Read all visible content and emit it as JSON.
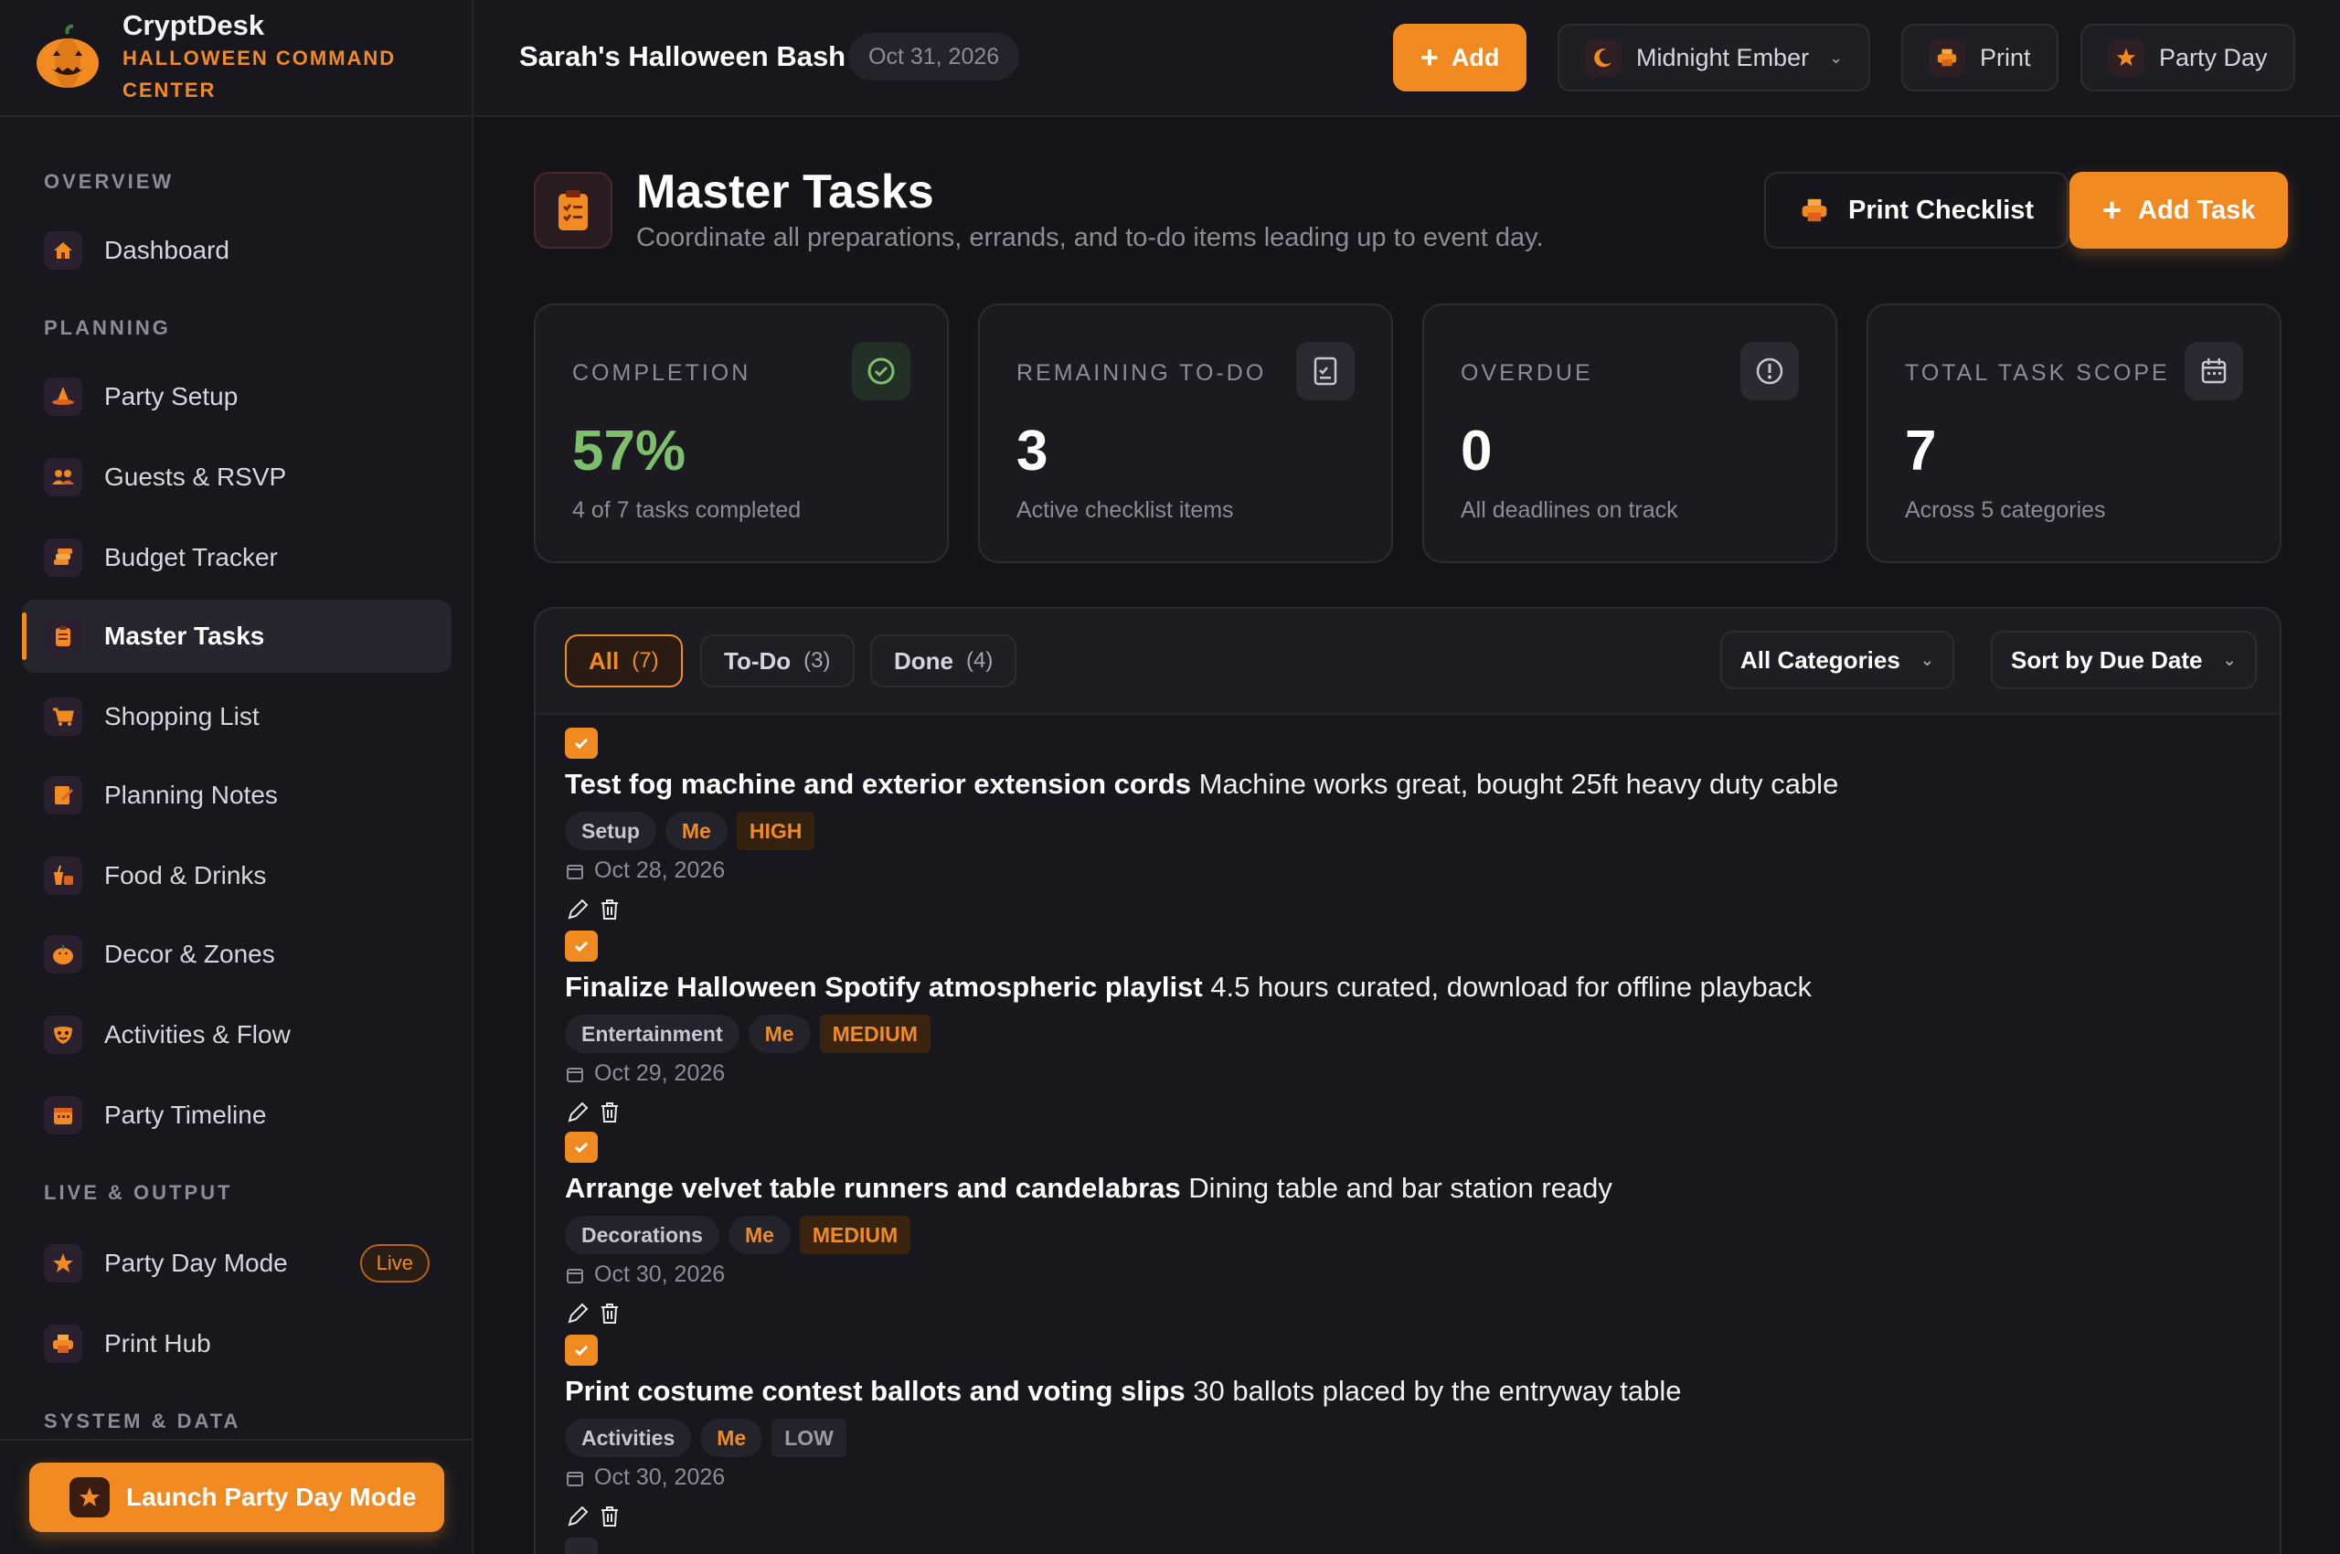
{
  "brand": {
    "name": "CryptDesk",
    "tagline_line1": "HALLOWEEN COMMAND",
    "tagline_line2": "CENTER"
  },
  "sidebar": {
    "sections": [
      "OVERVIEW",
      "PLANNING",
      "LIVE & OUTPUT",
      "SYSTEM & DATA"
    ],
    "items": [
      {
        "label": "Dashboard",
        "icon": "home-icon"
      },
      {
        "label": "Party Setup",
        "icon": "witch-hat-icon"
      },
      {
        "label": "Guests & RSVP",
        "icon": "people-icon"
      },
      {
        "label": "Budget Tracker",
        "icon": "coins-icon"
      },
      {
        "label": "Master Tasks",
        "icon": "clipboard-icon"
      },
      {
        "label": "Shopping List",
        "icon": "cart-icon"
      },
      {
        "label": "Planning Notes",
        "icon": "notepad-icon"
      },
      {
        "label": "Food & Drinks",
        "icon": "drink-icon"
      },
      {
        "label": "Decor & Zones",
        "icon": "pumpkin-icon"
      },
      {
        "label": "Activities & Flow",
        "icon": "mask-icon"
      },
      {
        "label": "Party Timeline",
        "icon": "calendar-icon"
      },
      {
        "label": "Party Day Mode",
        "icon": "star-icon",
        "badge": "Live"
      },
      {
        "label": "Print Hub",
        "icon": "printer-icon"
      }
    ],
    "launch_button": "Launch Party Day Mode"
  },
  "topbar": {
    "event_name": "Sarah's Halloween Bash",
    "event_date": "Oct 31, 2026",
    "add_label": "Add",
    "theme_label": "Midnight Ember",
    "print_label": "Print",
    "party_day_label": "Party Day"
  },
  "page": {
    "title": "Master Tasks",
    "subtitle": "Coordinate all preparations, errands, and to-do items leading up to event day.",
    "print_checklist": "Print Checklist",
    "add_task": "Add Task"
  },
  "stats": [
    {
      "label": "COMPLETION",
      "value": "57%",
      "note": "4 of 7 tasks completed",
      "icon": "check-circle-icon",
      "accent": "#7dbf6a"
    },
    {
      "label": "REMAINING TO-DO",
      "value": "3",
      "note": "Active checklist items",
      "icon": "checklist-icon",
      "accent": "#ffffff"
    },
    {
      "label": "OVERDUE",
      "value": "0",
      "note": "All deadlines on track",
      "icon": "alert-circle-icon",
      "accent": "#ffffff"
    },
    {
      "label": "TOTAL TASK SCOPE",
      "value": "7",
      "note": "Across 5 categories",
      "icon": "calendar-icon",
      "accent": "#ffffff"
    }
  ],
  "filters": {
    "tabs": [
      {
        "label": "All",
        "count": "(7)"
      },
      {
        "label": "To-Do",
        "count": "(3)"
      },
      {
        "label": "Done",
        "count": "(4)"
      }
    ],
    "category_select": "All Categories",
    "sort_select": "Sort by Due Date"
  },
  "tasks": [
    {
      "title": "Test fog machine and exterior extension cords",
      "note": "Machine works great, bought 25ft heavy duty cable",
      "category": "Setup",
      "owner": "Me",
      "priority": "HIGH",
      "due": "Oct 28, 2026",
      "done": true
    },
    {
      "title": "Finalize Halloween Spotify atmospheric playlist",
      "note": "4.5 hours curated, download for offline playback",
      "category": "Entertainment",
      "owner": "Me",
      "priority": "MEDIUM",
      "due": "Oct 29, 2026",
      "done": true
    },
    {
      "title": "Arrange velvet table runners and candelabras",
      "note": "Dining table and bar station ready",
      "category": "Decorations",
      "owner": "Me",
      "priority": "MEDIUM",
      "due": "Oct 30, 2026",
      "done": true
    },
    {
      "title": "Print costume contest ballots and voting slips",
      "note": "30 ballots placed by the entryway table",
      "category": "Activities",
      "owner": "Me",
      "priority": "LOW",
      "due": "Oct 30, 2026",
      "done": true
    }
  ],
  "colors": {
    "accent": "#f28a22",
    "background": "#141419",
    "success": "#7dbf6a"
  }
}
